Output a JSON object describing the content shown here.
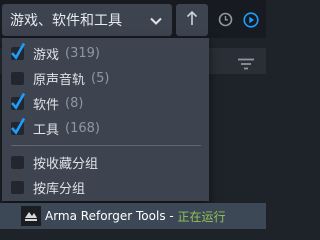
{
  "header": {
    "filter_dropdown_label": "游戏、软件和工具"
  },
  "filter_menu": {
    "items": [
      {
        "label": "游戏",
        "count": "(319)",
        "checked": true
      },
      {
        "label": "原声音轨",
        "count": "(5)",
        "checked": false
      },
      {
        "label": "软件",
        "count": "(8)",
        "checked": true
      },
      {
        "label": "工具",
        "count": "(168)",
        "checked": true
      }
    ],
    "group_options": [
      {
        "label": "按收藏分组",
        "checked": false
      },
      {
        "label": "按库分组",
        "checked": false
      }
    ]
  },
  "running_game": {
    "title": "Arma Reforger Tools",
    "separator": " - ",
    "status": "正在运行"
  },
  "colors": {
    "checkmark": "#1a9fff",
    "running_status": "#91c257",
    "menu_background": "#3d4450"
  },
  "icons": {
    "sort": "arrow-up-icon",
    "recent": "clock-icon",
    "play": "play-circle-icon",
    "filter": "filter-lines-icon"
  }
}
